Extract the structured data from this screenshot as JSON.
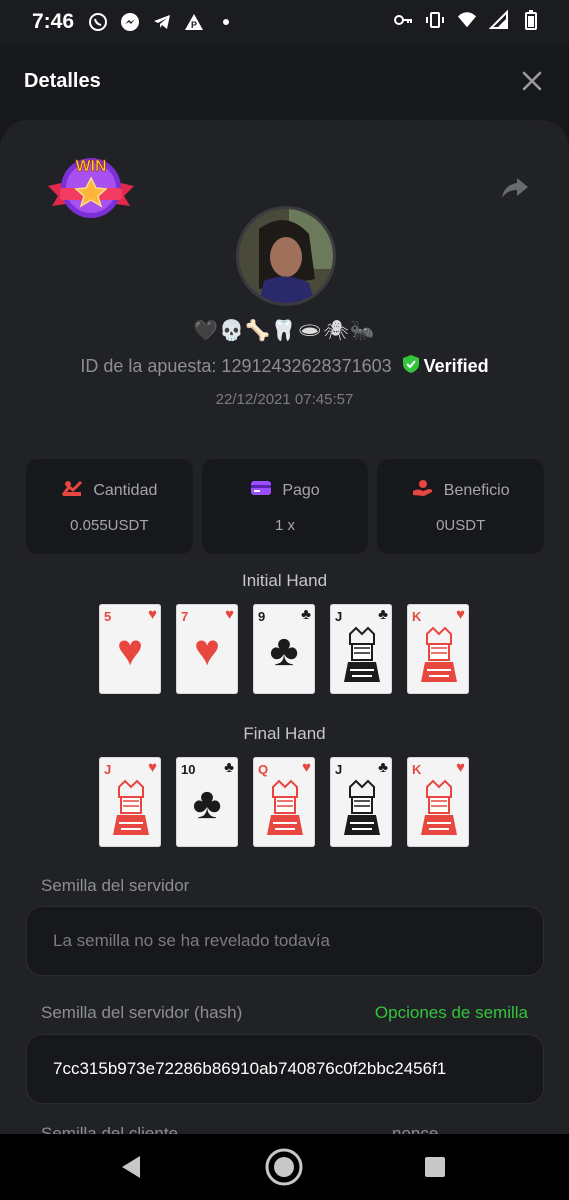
{
  "status_bar": {
    "time": "7:46",
    "left_icons": [
      "whatsapp-icon",
      "messenger-icon",
      "telegram-icon",
      "warning-icon",
      "dot-icon"
    ],
    "right_icons": [
      "key-icon",
      "vibrate-icon",
      "wifi-icon",
      "signal-icon",
      "battery-icon"
    ]
  },
  "header": {
    "title": "Detalles"
  },
  "profile": {
    "emojis": "🖤💀🦴🦷🕳🕷🐜",
    "bet_id_label": "ID de la apuesta: 12912432628371603",
    "verified_label": "Verified",
    "date": "22/12/2021 07:45:57"
  },
  "stats": [
    {
      "label": "Cantidad",
      "value": "0.055USDT",
      "icon": "coins-icon",
      "color": "#e8473f"
    },
    {
      "label": "Pago",
      "value": "1 x",
      "icon": "card-icon",
      "color": "#9b4dff"
    },
    {
      "label": "Beneficio",
      "value": "0USDT",
      "icon": "hand-coin-icon",
      "color": "#e8473f"
    }
  ],
  "initial_hand": {
    "title": "Initial Hand",
    "cards": [
      {
        "rank": "5",
        "suit": "♥",
        "color": "red",
        "face": false
      },
      {
        "rank": "7",
        "suit": "♥",
        "color": "red",
        "face": false
      },
      {
        "rank": "9",
        "suit": "♣",
        "color": "black",
        "face": false
      },
      {
        "rank": "J",
        "suit": "♣",
        "color": "black",
        "face": true
      },
      {
        "rank": "K",
        "suit": "♥",
        "color": "red",
        "face": true
      }
    ]
  },
  "final_hand": {
    "title": "Final Hand",
    "cards": [
      {
        "rank": "J",
        "suit": "♥",
        "color": "red",
        "face": true
      },
      {
        "rank": "10",
        "suit": "♣",
        "color": "black",
        "face": false
      },
      {
        "rank": "Q",
        "suit": "♥",
        "color": "red",
        "face": true
      },
      {
        "rank": "J",
        "suit": "♣",
        "color": "black",
        "face": true
      },
      {
        "rank": "K",
        "suit": "♥",
        "color": "red",
        "face": true
      }
    ]
  },
  "server_seed": {
    "label": "Semilla del servidor",
    "value": "La semilla no se ha revelado todavía"
  },
  "server_seed_hash": {
    "label": "Semilla del servidor (hash)",
    "link": "Opciones de semilla",
    "value": "7cc315b973e72286b86910ab740876c0f2bbc2456f1"
  },
  "client_seed": {
    "label": "Semilla del cliente",
    "nonce_label": "nonce"
  },
  "colors": {
    "accent_green": "#33c43c",
    "background": "#17181b",
    "sheet": "#212226"
  }
}
